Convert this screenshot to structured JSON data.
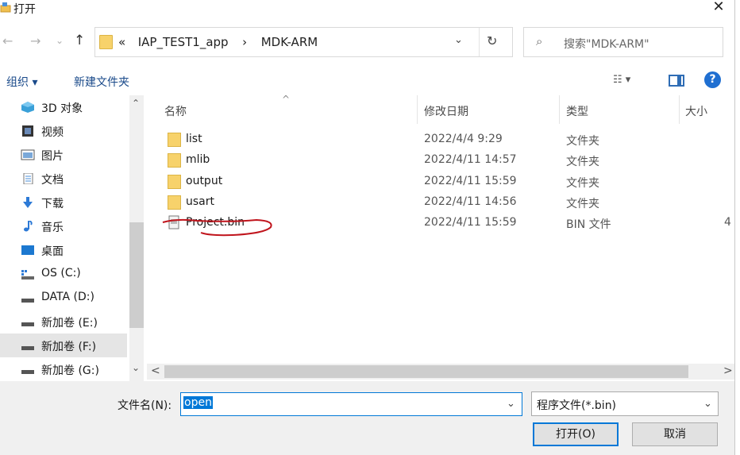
{
  "window": {
    "title": "打开",
    "close_glyph": "✕"
  },
  "nav": {
    "back_glyph": "←",
    "forward_glyph": "→",
    "recent_glyph": "⌄",
    "up_glyph": "↑",
    "breadcrumb_overflow": "«",
    "breadcrumb": [
      "IAP_TEST1_app",
      "MDK-ARM"
    ],
    "breadcrumb_sep": "›",
    "dropdown_glyph": "⌄",
    "refresh_glyph": "↻",
    "search_icon": "⌕",
    "search_placeholder": "搜索\"MDK-ARM\""
  },
  "toolbar": {
    "organize": "组织 ▾",
    "new_folder": "新建文件夹",
    "view_glyph": "☷ ▾",
    "help_glyph": "?"
  },
  "sidebar": {
    "items": [
      {
        "label": "3D 对象",
        "icon": "cube-icon"
      },
      {
        "label": "视频",
        "icon": "video-icon"
      },
      {
        "label": "图片",
        "icon": "picture-icon"
      },
      {
        "label": "文档",
        "icon": "document-icon"
      },
      {
        "label": "下载",
        "icon": "download-icon"
      },
      {
        "label": "音乐",
        "icon": "music-icon"
      },
      {
        "label": "桌面",
        "icon": "desktop-icon"
      },
      {
        "label": "OS (C:)",
        "icon": "windows-drive-icon"
      },
      {
        "label": "DATA (D:)",
        "icon": "drive-icon"
      },
      {
        "label": "新加卷 (E:)",
        "icon": "drive-icon"
      },
      {
        "label": "新加卷 (F:)",
        "icon": "drive-icon",
        "selected": true
      },
      {
        "label": "新加卷 (G:)",
        "icon": "drive-icon"
      }
    ],
    "scroll_up": "⌃",
    "scroll_down": "⌄"
  },
  "columns": {
    "name": "名称",
    "date": "修改日期",
    "type": "类型",
    "size": "大小",
    "sort_caret": "^"
  },
  "files": [
    {
      "name": "list",
      "date": "2022/4/4 9:29",
      "type": "文件夹",
      "size": "",
      "kind": "folder"
    },
    {
      "name": "mlib",
      "date": "2022/4/11 14:57",
      "type": "文件夹",
      "size": "",
      "kind": "folder"
    },
    {
      "name": "output",
      "date": "2022/4/11 15:59",
      "type": "文件夹",
      "size": "",
      "kind": "folder"
    },
    {
      "name": "usart",
      "date": "2022/4/11 14:56",
      "type": "文件夹",
      "size": "",
      "kind": "folder"
    },
    {
      "name": "Project.bin",
      "date": "2022/4/11 15:59",
      "type": "BIN 文件",
      "size": "4",
      "kind": "bin"
    }
  ],
  "hscroll": {
    "left": "<",
    "right": ">"
  },
  "bottom": {
    "filename_label": "文件名(N):",
    "filename_value": "open",
    "filter_value": "程序文件(*.bin)",
    "dropdown_glyph": "⌄",
    "open_button": "打开(O)",
    "cancel_button": "取消"
  },
  "colors": {
    "accent": "#0078d7",
    "folder": "#f7d26b",
    "scribble": "#c0141c"
  }
}
